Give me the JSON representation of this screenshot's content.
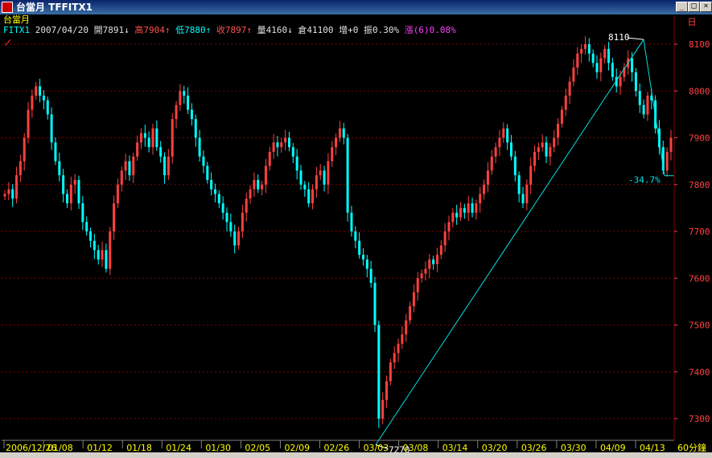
{
  "window": {
    "title": "台當月 TFFITX1",
    "min_label": "_",
    "max_label": "□",
    "close_label": "×"
  },
  "header": {
    "chart_name": "台當月",
    "symbol": "FITX1",
    "date": "2007/04/20",
    "open_label": "開",
    "open_value": "7891",
    "high_label": "高",
    "high_value": "7904",
    "low_label": "低",
    "low_value": "7880",
    "close_label": "收",
    "close_value": "7897",
    "volume_label": "量",
    "volume_value": "4160",
    "oi_label": "倉",
    "oi_value": "41100",
    "inc_label": "增",
    "inc_value": "+0",
    "amp_label": "振",
    "amp_value": "0.30%",
    "chg_label": "漲",
    "chg_value": "(6)0.08%"
  },
  "colors": {
    "up": "#ff4040",
    "down": "#00ffff",
    "grid": "#800000",
    "axis_text": "#ff4040",
    "date_text": "#ffff00",
    "line": "#00e0e0"
  },
  "chart_data": {
    "type": "candlestick",
    "ylim": [
      7270,
      8140
    ],
    "y_ticks": [
      7300,
      7400,
      7500,
      7600,
      7700,
      7800,
      7900,
      8000,
      8100
    ],
    "x_ticks": [
      "2006/12/26",
      "01/08",
      "01/12",
      "01/18",
      "01/24",
      "01/30",
      "02/05",
      "02/09",
      "02/26",
      "03/03",
      "03/08",
      "03/14",
      "03/20",
      "03/26",
      "03/30",
      "04/09",
      "04/13"
    ],
    "period_label": "60分鐘",
    "axis_top_label": "日",
    "trend_line": {
      "start_value": 7270,
      "end_value": 8110,
      "start_label": "7270",
      "end_label": "8110",
      "retrace_label": "-34.7%",
      "retrace_value": 7819
    },
    "close_path": [
      7780,
      7790,
      7770,
      7820,
      7850,
      7900,
      7960,
      7990,
      8010,
      7990,
      7980,
      7950,
      7890,
      7850,
      7820,
      7780,
      7760,
      7800,
      7810,
      7760,
      7720,
      7700,
      7680,
      7660,
      7640,
      7660,
      7620,
      7700,
      7760,
      7800,
      7830,
      7850,
      7820,
      7860,
      7890,
      7910,
      7900,
      7880,
      7920,
      7880,
      7860,
      7820,
      7860,
      7940,
      7970,
      8000,
      7990,
      7960,
      7940,
      7900,
      7860,
      7840,
      7810,
      7790,
      7780,
      7760,
      7740,
      7720,
      7700,
      7670,
      7700,
      7740,
      7770,
      7790,
      7810,
      7790,
      7800,
      7840,
      7870,
      7890,
      7880,
      7890,
      7900,
      7880,
      7860,
      7830,
      7800,
      7790,
      7760,
      7790,
      7820,
      7830,
      7800,
      7850,
      7880,
      7900,
      7920,
      7900,
      7740,
      7700,
      7680,
      7650,
      7640,
      7620,
      7590,
      7500,
      7300,
      7340,
      7380,
      7420,
      7440,
      7460,
      7480,
      7510,
      7540,
      7570,
      7600,
      7610,
      7620,
      7640,
      7630,
      7650,
      7670,
      7700,
      7720,
      7740,
      7730,
      7750,
      7740,
      7760,
      7740,
      7760,
      7780,
      7800,
      7830,
      7860,
      7880,
      7900,
      7920,
      7890,
      7860,
      7820,
      7780,
      7760,
      7800,
      7840,
      7870,
      7880,
      7890,
      7860,
      7880,
      7900,
      7930,
      7960,
      7990,
      8020,
      8050,
      8080,
      8090,
      8100,
      8080,
      8060,
      8040,
      8070,
      8090,
      8060,
      8030,
      8010,
      8030,
      8050,
      8070,
      8040,
      8000,
      7970,
      7950,
      7990,
      7980,
      7920,
      7880,
      7830,
      7870,
      7900
    ]
  }
}
